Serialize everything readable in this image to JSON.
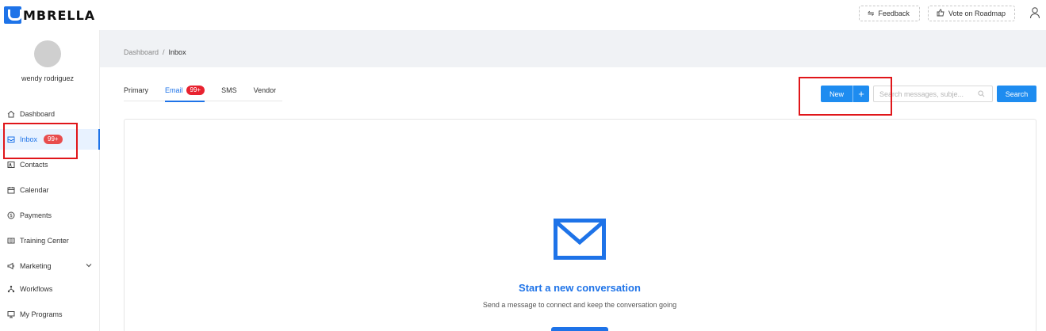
{
  "brand": {
    "logo_text": "MBRELLA"
  },
  "topbar": {
    "feedback_label": "Feedback",
    "roadmap_label": "Vote on Roadmap",
    "user_icon": "user-icon"
  },
  "sidebar": {
    "user_name": "wendy rodriguez",
    "items": [
      {
        "label": "Dashboard",
        "icon": "home-icon"
      },
      {
        "label": "Inbox",
        "icon": "inbox-icon",
        "badge": "99+",
        "active": true
      },
      {
        "label": "Contacts",
        "icon": "contacts-icon"
      },
      {
        "label": "Calendar",
        "icon": "calendar-icon"
      },
      {
        "label": "Payments",
        "icon": "payments-icon"
      },
      {
        "label": "Training Center",
        "icon": "training-icon"
      },
      {
        "label": "Marketing",
        "icon": "megaphone-icon",
        "expandable": true
      },
      {
        "label": "Workflows",
        "icon": "workflow-icon"
      },
      {
        "label": "My Programs",
        "icon": "monitor-icon"
      }
    ]
  },
  "breadcrumb": {
    "root": "Dashboard",
    "separator": "/",
    "current": "Inbox"
  },
  "tabs": [
    {
      "label": "Primary"
    },
    {
      "label": "Email",
      "badge": "99+",
      "active": true
    },
    {
      "label": "SMS"
    },
    {
      "label": "Vendor"
    }
  ],
  "actions": {
    "new_label": "New",
    "search_placeholder": "Search messages, subje...",
    "search_label": "Search"
  },
  "empty_state": {
    "title": "Start a new conversation",
    "subtitle": "Send a message to connect and keep the conversation going"
  },
  "colors": {
    "accent": "#1e73e8",
    "badge": "#e8222f",
    "highlight": "#e0161a"
  }
}
